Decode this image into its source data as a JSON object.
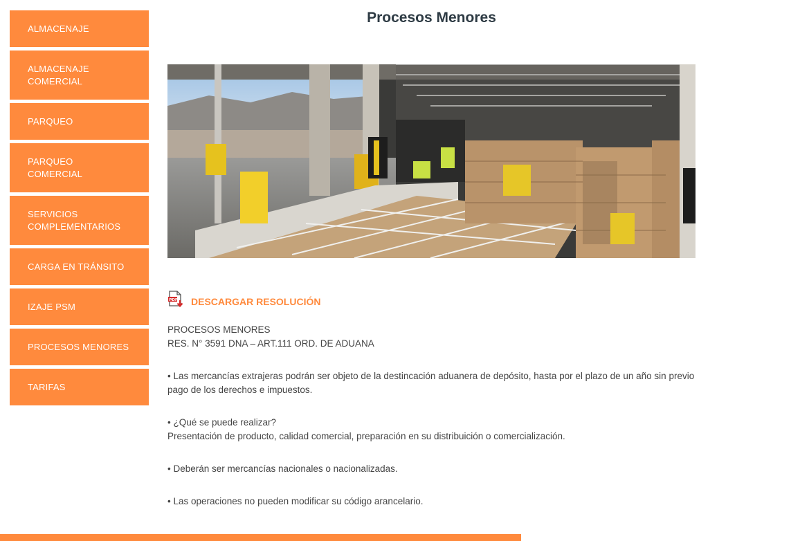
{
  "sidebar": {
    "items": [
      {
        "label": "ALMACENAJE"
      },
      {
        "label": "ALMACENAJE\nCOMERCIAL"
      },
      {
        "label": "PARQUEO"
      },
      {
        "label": "PARQUEO\nCOMERCIAL"
      },
      {
        "label": "SERVICIOS\nCOMPLEMENTARIOS"
      },
      {
        "label": "CARGA EN TRÁNSITO"
      },
      {
        "label": "IZAJE PSM"
      },
      {
        "label": "PROCESOS MENORES"
      },
      {
        "label": "TARIFAS"
      }
    ]
  },
  "page": {
    "title": "Procesos Menores"
  },
  "download": {
    "label": "DESCARGAR RESOLUCIÓN",
    "icon": "pdf-download-icon"
  },
  "content": {
    "heading1": "PROCESOS MENORES",
    "heading2": "RES. N° 3591 DNA – ART.111 ORD. DE ADUANA",
    "p1": "• Las mercancías extrajeras podrán ser objeto de la destincación aduanera de depósito, hasta por el plazo de un año sin previo pago de los derechos e impuestos.",
    "p2a": "• ¿Qué se puede realizar?",
    "p2b": "Presentación de producto, calidad comercial, preparación en su distribuición o comercialización.",
    "p3": "• Deberán ser mercancías nacionales o nacionalizadas.",
    "p4": "• Las operaciones no pueden modificar su código arancelario."
  },
  "colors": {
    "accent": "#ff8a3d",
    "title": "#2e3b44",
    "text": "#444444"
  }
}
